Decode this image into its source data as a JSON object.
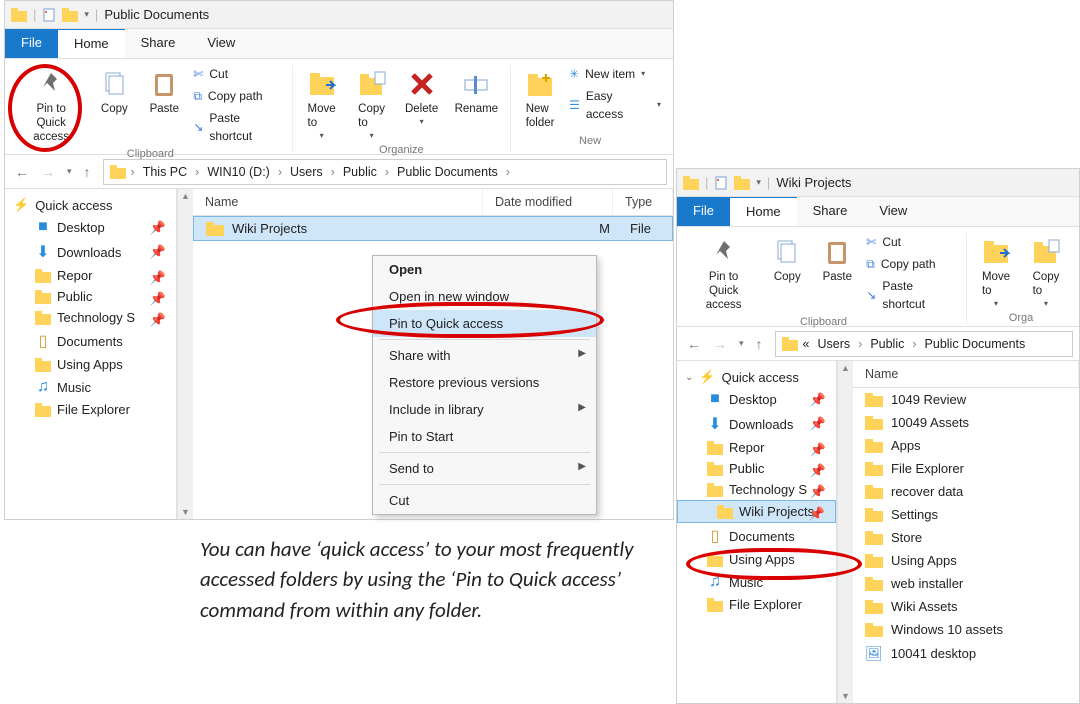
{
  "window1": {
    "title": "Public Documents",
    "tabs": {
      "file": "File",
      "home": "Home",
      "share": "Share",
      "view": "View"
    },
    "ribbon": {
      "pinqa": "Pin to Quick\naccess",
      "copy": "Copy",
      "paste": "Paste",
      "cut": "Cut",
      "copypath": "Copy path",
      "pastesc": "Paste shortcut",
      "clipboard_group": "Clipboard",
      "moveto": "Move\nto",
      "copyto": "Copy\nto",
      "delete": "Delete",
      "rename": "Rename",
      "organize_group": "Organize",
      "newfolder": "New\nfolder",
      "newitem": "New item",
      "easyaccess": "Easy access",
      "new_group": "New"
    },
    "crumbs": [
      "This PC",
      "WIN10 (D:)",
      "Users",
      "Public",
      "Public Documents"
    ],
    "sidebar": {
      "qa": "Quick access",
      "items": [
        "Desktop",
        "Downloads",
        "Repor",
        "Public",
        "Technology S",
        "Documents",
        "Using Apps",
        "Music",
        "File Explorer"
      ]
    },
    "cols": {
      "name": "Name",
      "date": "Date modified",
      "type": "Type"
    },
    "row": {
      "name": "Wiki Projects",
      "date": "M",
      "type": "File"
    }
  },
  "ctx": {
    "open": "Open",
    "opennew": "Open in new window",
    "pinqa": "Pin to Quick access",
    "sharewith": "Share with",
    "restore": "Restore previous versions",
    "include": "Include in library",
    "pinstart": "Pin to Start",
    "sendto": "Send to",
    "cut": "Cut"
  },
  "window2": {
    "title": "Wiki Projects",
    "tabs": {
      "file": "File",
      "home": "Home",
      "share": "Share",
      "view": "View"
    },
    "ribbon": {
      "pinqa": "Pin to Quick\naccess",
      "copy": "Copy",
      "paste": "Paste",
      "cut": "Cut",
      "copypath": "Copy path",
      "pastesc": "Paste shortcut",
      "clipboard_group": "Clipboard",
      "moveto": "Move\nto",
      "copyto": "Copy\nto",
      "organize_group": "Orga"
    },
    "crumbs_prefix": "«",
    "crumbs": [
      "Users",
      "Public",
      "Public Documents"
    ],
    "sidebar": {
      "qa": "Quick access",
      "items": [
        "Desktop",
        "Downloads",
        "Repor",
        "Public",
        "Technology S",
        "Wiki Projects",
        "Documents",
        "Using Apps",
        "Music",
        "File Explorer"
      ]
    },
    "cols": {
      "name": "Name"
    },
    "files": [
      "1049 Review",
      "10049 Assets",
      "Apps",
      "File Explorer",
      "recover data",
      "Settings",
      "Store",
      "Using Apps",
      "web installer",
      "Wiki Assets",
      "Windows 10 assets",
      "10041 desktop"
    ]
  },
  "caption": "You can have ‘quick access’ to your most frequently accessed folders by using the ‘Pin to Quick access’ command from within any folder."
}
